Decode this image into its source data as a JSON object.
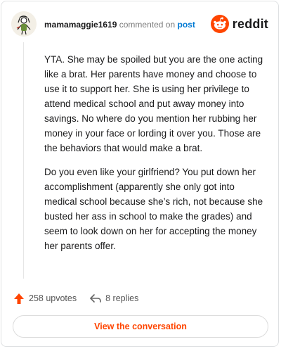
{
  "header": {
    "username": "mamamaggie1619",
    "action": "commented on",
    "post_link": "post",
    "brand": "reddit"
  },
  "comment": {
    "paragraphs": [
      "YTA. She may be spoiled but you are the one acting like a brat. Her parents have money and choose to use it to support her. She is using her privilege to attend medical school and put away money into savings. No where do you mention her rubbing her money in your face or lording it over you. Those are the behaviors that would make a brat.",
      "Do you even like your girlfriend? You put down her accomplishment (apparently she only got into medical school because she’s rich, not because she busted her ass in school to make the grades) and seem to look down on her for accepting the money her parents offer."
    ]
  },
  "footer": {
    "upvotes": "258 upvotes",
    "replies": "8 replies"
  },
  "cta": {
    "label": "View the conversation"
  },
  "colors": {
    "brand_orange": "#ff4500",
    "link_blue": "#0079d3",
    "text": "#1a1a1b",
    "muted": "#7c7c7c"
  },
  "icons": {
    "avatar": "avatar",
    "logo": "reddit-snoo-icon",
    "upvote": "upvote-arrow-icon",
    "reply": "reply-arrow-icon"
  }
}
